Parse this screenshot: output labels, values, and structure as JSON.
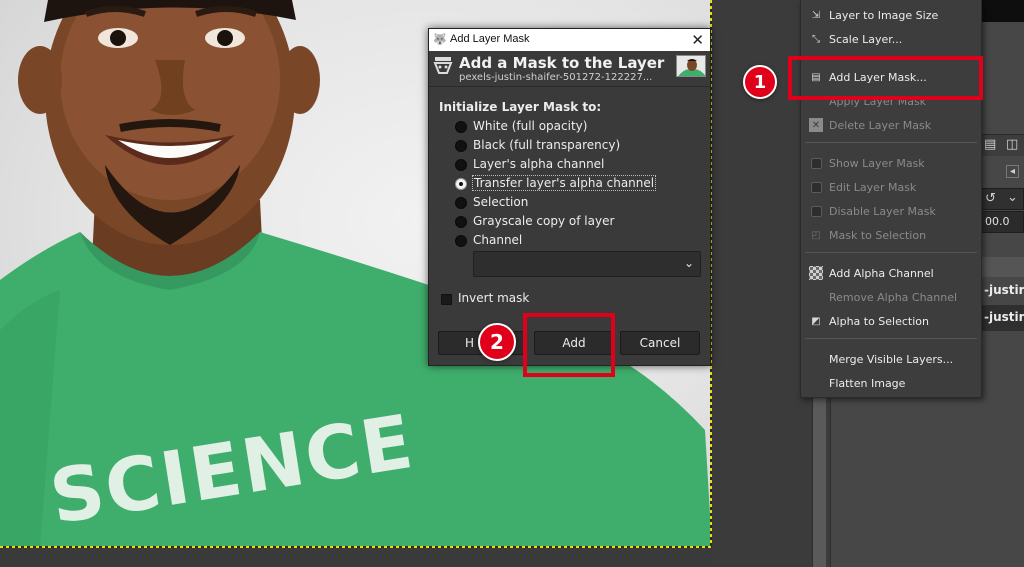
{
  "menu": {
    "items": [
      {
        "label": "Layer to Image Size",
        "enabled": true,
        "icon": "resize-icon"
      },
      {
        "label": "Scale Layer...",
        "enabled": true,
        "icon": "scale-icon"
      },
      {
        "label": "Add Layer Mask...",
        "enabled": true,
        "icon": "layer-mask-icon",
        "highlighted": true
      },
      {
        "label": "Apply Layer Mask",
        "enabled": false,
        "icon": ""
      },
      {
        "label": "Delete Layer Mask",
        "enabled": false,
        "icon": "delete-icon"
      },
      {
        "label": "Show Layer Mask",
        "enabled": false,
        "icon": "checkbox"
      },
      {
        "label": "Edit Layer Mask",
        "enabled": false,
        "icon": "checkbox"
      },
      {
        "label": "Disable Layer Mask",
        "enabled": false,
        "icon": "checkbox"
      },
      {
        "label": "Mask to Selection",
        "enabled": false,
        "icon": "mask-selection-icon"
      },
      {
        "label": "Add Alpha Channel",
        "enabled": true,
        "icon": "alpha-icon"
      },
      {
        "label": "Remove Alpha Channel",
        "enabled": false,
        "icon": ""
      },
      {
        "label": "Alpha to Selection",
        "enabled": true,
        "icon": "alpha-selection-icon"
      },
      {
        "label": "Merge Visible Layers...",
        "enabled": true,
        "icon": ""
      },
      {
        "label": "Flatten Image",
        "enabled": true,
        "icon": ""
      }
    ]
  },
  "dialog": {
    "window_title": "Add Layer Mask",
    "heading": "Add a Mask to the Layer",
    "subtitle": "pexels-justin-shaifer-501272-122227...",
    "section_label": "Initialize Layer Mask to:",
    "options": [
      {
        "label": "White (full opacity)",
        "selected": false
      },
      {
        "label": "Black (full transparency)",
        "selected": false
      },
      {
        "label": "Layer's alpha channel",
        "selected": false
      },
      {
        "label": "Transfer layer's alpha channel",
        "selected": true
      },
      {
        "label": "Selection",
        "selected": false
      },
      {
        "label": "Grayscale copy of layer",
        "selected": false
      },
      {
        "label": "Channel",
        "selected": false
      }
    ],
    "channel_value": "",
    "invert_label": "Invert mask",
    "invert_checked": false,
    "help_label": "H",
    "add_label": "Add",
    "cancel_label": "Cancel"
  },
  "dock": {
    "layer_name_1": "-justir",
    "layer_name_2": "-justir",
    "opacity_value": "00.0"
  },
  "photo": {
    "shirt_text": "SCIENCE",
    "shirt_color": "#3fae6d"
  },
  "annotations": {
    "badge_1": "1",
    "badge_2": "2",
    "color": "#e0001a"
  }
}
